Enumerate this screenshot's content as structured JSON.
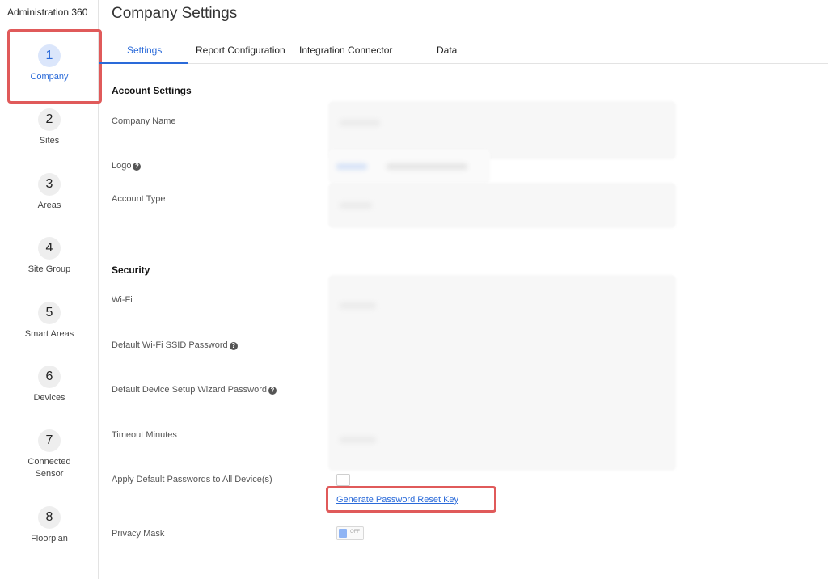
{
  "app": {
    "title": "Administration 360"
  },
  "sidebar": {
    "steps": [
      {
        "number": "1",
        "label": "Company"
      },
      {
        "number": "2",
        "label": "Sites"
      },
      {
        "number": "3",
        "label": "Areas"
      },
      {
        "number": "4",
        "label": "Site Group"
      },
      {
        "number": "5",
        "label": "Smart Areas"
      },
      {
        "number": "6",
        "label": "Devices"
      },
      {
        "number": "7",
        "label_line1": "Connected",
        "label_line2": "Sensor"
      },
      {
        "number": "8",
        "label": "Floorplan"
      }
    ]
  },
  "page": {
    "title": "Company Settings"
  },
  "tabs": [
    {
      "label": "Settings"
    },
    {
      "label": "Report Configuration"
    },
    {
      "label": "Integration Connector"
    },
    {
      "label": "Data"
    }
  ],
  "account": {
    "title": "Account Settings",
    "company_name_label": "Company Name",
    "logo_label": "Logo",
    "account_type_label": "Account Type"
  },
  "security": {
    "title": "Security",
    "wifi_label": "Wi-Fi",
    "wifi_ssid_password_label": "Default Wi-Fi SSID Password",
    "wizard_password_label": "Default Device Setup Wizard Password",
    "timeout_label": "Timeout Minutes",
    "apply_defaults_label": "Apply Default Passwords to All Device(s)",
    "generate_key_link": "Generate Password Reset Key",
    "privacy_mask_label": "Privacy Mask",
    "privacy_mask_state": "OFF"
  },
  "icons": {
    "help": "?"
  },
  "colors": {
    "accent": "#2a6ad9",
    "highlight": "#e05a5a"
  }
}
